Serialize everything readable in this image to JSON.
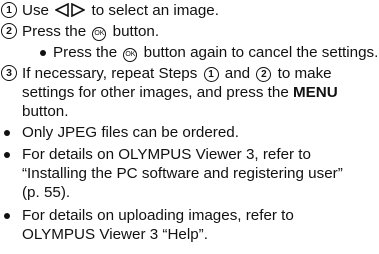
{
  "steps": [
    {
      "number": "1",
      "before": "Use",
      "after": "to select an image.",
      "icon": "left-right-arrow-icon"
    },
    {
      "number": "2",
      "before": "Press the",
      "after": "button.",
      "icon": "ok-button-icon",
      "icon_text": "OK",
      "sub": [
        {
          "before": "Press the",
          "after": "button again to cancel the settings.",
          "icon": "ok-button-icon",
          "icon_text": "OK"
        }
      ]
    },
    {
      "number": "3",
      "line1_a": "If necessary, repeat Steps",
      "ref1": "1",
      "line1_b": "and",
      "ref2": "2",
      "line1_c": "to make",
      "line2_a": "settings for other images, and press the",
      "line2_menu": "MENU",
      "line3": "button."
    }
  ],
  "notes": [
    {
      "lines": [
        "Only JPEG files can be ordered."
      ]
    },
    {
      "lines": [
        "For details on OLYMPUS Viewer 3, refer to",
        "“Installing the PC software and registering user”",
        "(p. 55)."
      ]
    },
    {
      "lines": [
        "For details on uploading images, refer to",
        "OLYMPUS Viewer 3 “Help”."
      ]
    }
  ]
}
